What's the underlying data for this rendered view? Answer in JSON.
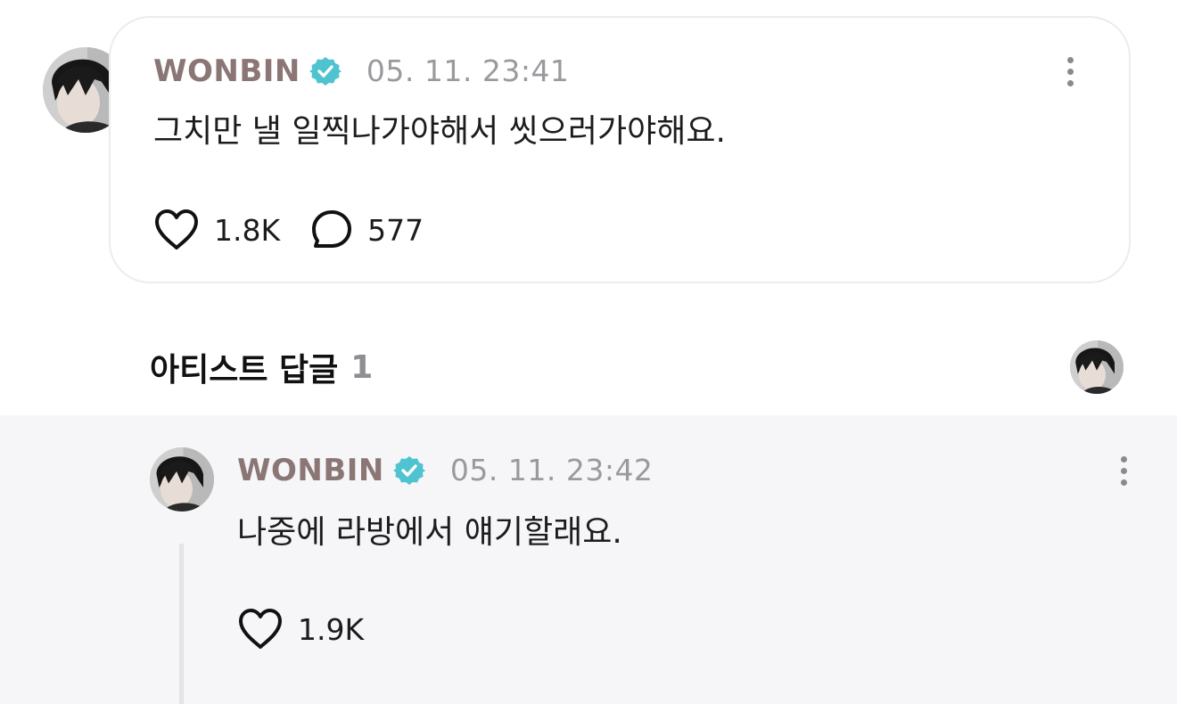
{
  "post": {
    "author": "WONBIN",
    "timestamp": "05. 11. 23:41",
    "text": "그치만 낼 일찍나가야해서 씻으러가야해요.",
    "likes": "1.8K",
    "comments": "577"
  },
  "artist_replies": {
    "title": "아티스트 답글",
    "count": "1"
  },
  "reply": {
    "author": "WONBIN",
    "timestamp": "05. 11. 23:42",
    "text": "나중에 라방에서 얘기할래요.",
    "likes": "1.9K"
  },
  "colors": {
    "author_name": "#8a7674",
    "verified_badge": "#4fc3cf",
    "timestamp": "#9a9a9e",
    "reply_background": "#f6f6f8"
  },
  "icons": {
    "verified": "verified-badge-icon",
    "more": "more-vertical-icon",
    "like": "heart-outline-icon",
    "comment": "speech-bubble-icon"
  }
}
